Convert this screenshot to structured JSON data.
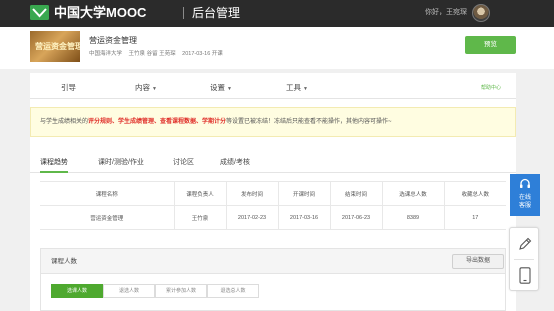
{
  "header": {
    "logo_text": "中国大学MOOC",
    "subtitle": "后台管理",
    "greeting": "你好，王宛琛"
  },
  "course": {
    "thumb_text": "营运资金管理",
    "title": "营运资金管理",
    "meta": {
      "school": "中国海洋大学",
      "teachers": "王竹泉 谷留 王苑琛",
      "start": "2017-03-16 开课"
    },
    "preview_label": "预览"
  },
  "nav": {
    "items": [
      {
        "label": "引导",
        "has_caret": false
      },
      {
        "label": "内容",
        "has_caret": true
      },
      {
        "label": "设置",
        "has_caret": true
      },
      {
        "label": "工具",
        "has_caret": true
      }
    ],
    "help_label": "帮助中心"
  },
  "notice": {
    "prefix": "与学生成绩相关的",
    "highlight": "评分规则、学生成绩管理、查看课程数据、学期计分",
    "suffix": "等设置已被冻结！冻结后只能查看不能操作，其他内容可操作~"
  },
  "tabs": [
    {
      "label": "课程趋势",
      "active": true
    },
    {
      "label": "课时/测验/作业",
      "active": false
    },
    {
      "label": "讨论区",
      "active": false
    },
    {
      "label": "成绩/考核",
      "active": false
    }
  ],
  "stats_table": {
    "headers": [
      "课程名称",
      "课程负责人",
      "发布时间",
      "开课时间",
      "结束时间",
      "选课总人数",
      "收藏总人数"
    ],
    "rows": [
      [
        "营运资金管理",
        "王竹泉",
        "2017-02-23",
        "2017-03-16",
        "2017-06-23",
        "8389",
        "17"
      ]
    ]
  },
  "course_count": {
    "title": "课程人数",
    "export_label": "导出数据",
    "segments": [
      {
        "label": "选课人数",
        "active": true
      },
      {
        "label": "退选人数",
        "active": false
      },
      {
        "label": "累计参加人数",
        "active": false
      },
      {
        "label": "退选总人数",
        "active": false
      }
    ]
  },
  "side": {
    "service_line1": "在线",
    "service_line2": "客服"
  },
  "colors": {
    "topbar": "#2b2b2b",
    "accent_green": "#5fb84a",
    "notice_red": "#e0302a",
    "service_blue": "#2e7fd8"
  }
}
